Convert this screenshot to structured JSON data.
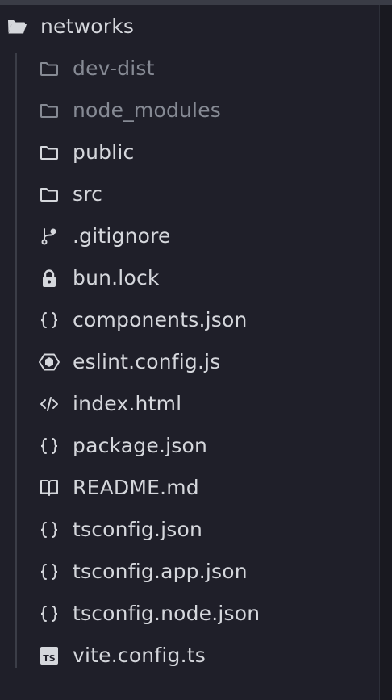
{
  "root": {
    "label": "networks",
    "icon": "folder-open-icon"
  },
  "items": [
    {
      "label": "dev-dist",
      "icon": "folder-icon",
      "dimmed": true
    },
    {
      "label": "node_modules",
      "icon": "folder-icon",
      "dimmed": true
    },
    {
      "label": "public",
      "icon": "folder-icon",
      "dimmed": false
    },
    {
      "label": "src",
      "icon": "folder-icon",
      "dimmed": false
    },
    {
      "label": ".gitignore",
      "icon": "git-branch-icon",
      "dimmed": false
    },
    {
      "label": "bun.lock",
      "icon": "lock-icon",
      "dimmed": false
    },
    {
      "label": "components.json",
      "icon": "json-braces-icon",
      "dimmed": false
    },
    {
      "label": "eslint.config.js",
      "icon": "eslint-icon",
      "dimmed": false
    },
    {
      "label": "index.html",
      "icon": "code-tag-icon",
      "dimmed": false
    },
    {
      "label": "package.json",
      "icon": "json-braces-icon",
      "dimmed": false
    },
    {
      "label": "README.md",
      "icon": "book-icon",
      "dimmed": false
    },
    {
      "label": "tsconfig.json",
      "icon": "json-braces-icon",
      "dimmed": false
    },
    {
      "label": "tsconfig.app.json",
      "icon": "json-braces-icon",
      "dimmed": false
    },
    {
      "label": "tsconfig.node.json",
      "icon": "json-braces-icon",
      "dimmed": false
    },
    {
      "label": "vite.config.ts",
      "icon": "typescript-icon",
      "dimmed": false
    }
  ],
  "colors": {
    "background": "#1f1f29",
    "text": "#d5d7dc",
    "dimmed_text": "#868a94",
    "guide_line": "#3b3d47"
  }
}
